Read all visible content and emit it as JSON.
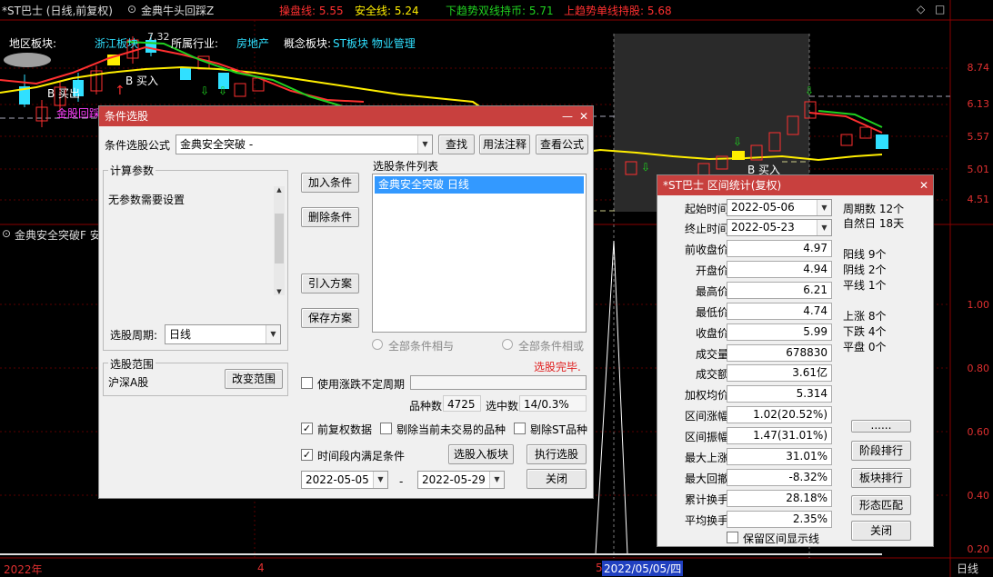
{
  "topbar": {
    "stock": "*ST巴士 (日线,前复权)",
    "indicator": "金典牛头回踩Z",
    "l1_label": "操盘线:",
    "l1_value": "5.55",
    "l2_label": "安全线:",
    "l2_value": "5.24",
    "l3_label": "下趋势双线持币:",
    "l3_value": "5.71",
    "l4_label": "上趋势单线持股:",
    "l4_value": "5.68"
  },
  "infoline": {
    "region_label": "地区板块:",
    "region_value": "浙江板块",
    "industry_label": "所属行业:",
    "industry_value": "房地产",
    "concept_label": "概念板块:",
    "concept_value": "ST板块 物业管理",
    "price_tag": "7.32"
  },
  "chart_marks": {
    "buy1": "B 买入",
    "buy2": "B 买入",
    "hold": "B 买出",
    "gold": "金股回踩"
  },
  "price_scale": [
    "8.74",
    "6.13",
    "5.57",
    "5.01",
    "4.51"
  ],
  "sub_scale": [
    "1.00",
    "0.80",
    "0.60",
    "0.40",
    "0.20"
  ],
  "sub_indicator": "金典安全突破F 安",
  "bottom_axis": {
    "year": "2022年",
    "m4": "4",
    "m5": "5",
    "cursor_date": "2022/05/05/四",
    "period": "日线"
  },
  "selector": {
    "title": "条件选股",
    "formula_label": "条件选股公式",
    "formula_value": "金典安全突破 -",
    "btn_find": "查找",
    "btn_usage": "用法注释",
    "btn_view": "查看公式",
    "params_title": "计算参数",
    "params_text": "无参数需要设置",
    "period_label": "选股周期:",
    "period_value": "日线",
    "btn_add": "加入条件",
    "btn_delete": "删除条件",
    "btn_import": "引入方案",
    "btn_save": "保存方案",
    "list_title": "选股条件列表",
    "list_items": [
      "金典安全突破  日线"
    ],
    "radio_and": "全部条件相与",
    "radio_or": "全部条件相或",
    "status": "选股完毕.",
    "range_title": "选股范围",
    "range_value": "沪深A股",
    "btn_change_range": "改变范围",
    "use_period_label": "使用涨跌不定周期",
    "count_label": "品种数",
    "count_value": "4725",
    "selected_label": "选中数",
    "selected_value": "14/0.3%",
    "chk_fq": "前复权数据",
    "chk_exclude_untraded": "剔除当前未交易的品种",
    "chk_exclude_st": "剔除ST品种",
    "chk_time": "时间段内满足条件",
    "btn_to_sector": "选股入板块",
    "btn_execute": "执行选股",
    "date_from": "2022-05-05",
    "date_dash": "-",
    "date_to": "2022-05-29",
    "btn_close": "关闭"
  },
  "stats": {
    "title": "*ST巴士 区间统计(复权)",
    "start_label": "起始时间",
    "start_value": "2022-05-06",
    "end_label": "终止时间",
    "end_value": "2022-05-23",
    "rows": [
      {
        "label": "前收盘价",
        "value": "4.97"
      },
      {
        "label": "开盘价",
        "value": "4.94"
      },
      {
        "label": "最高价",
        "value": "6.21"
      },
      {
        "label": "最低价",
        "value": "4.74"
      },
      {
        "label": "收盘价",
        "value": "5.99"
      },
      {
        "label": "成交量",
        "value": "678830"
      },
      {
        "label": "成交额",
        "value": "3.61亿"
      },
      {
        "label": "加权均价",
        "value": "5.314"
      },
      {
        "label": "区间涨幅",
        "value": "1.02(20.52%)"
      },
      {
        "label": "区间振幅",
        "value": "1.47(31.01%)"
      },
      {
        "label": "最大上涨",
        "value": "31.01%"
      },
      {
        "label": "最大回撤",
        "value": "-8.32%"
      },
      {
        "label": "累计换手",
        "value": "28.18%"
      },
      {
        "label": "平均换手",
        "value": "2.35%"
      }
    ],
    "periods": "周期数 12个",
    "natural_days": "自然日 18天",
    "yang": "阳线 9个",
    "yin": "阴线 2个",
    "flat": "平线 1个",
    "up": "上涨 8个",
    "down": "下跌 4个",
    "even": "平盘 0个",
    "btn_more": "......",
    "btn_stage": "阶段排行",
    "btn_sector": "板块排行",
    "btn_pattern": "形态匹配",
    "btn_close": "关闭",
    "keep_label": "保留区间显示线"
  },
  "colors": {
    "title_bar": "#c8403e",
    "up_red": "#ff3030",
    "down_cyan": "#30e0ff",
    "ma_yellow": "#ffee00",
    "ma_green": "#20d020",
    "selection": "#3399ff"
  }
}
